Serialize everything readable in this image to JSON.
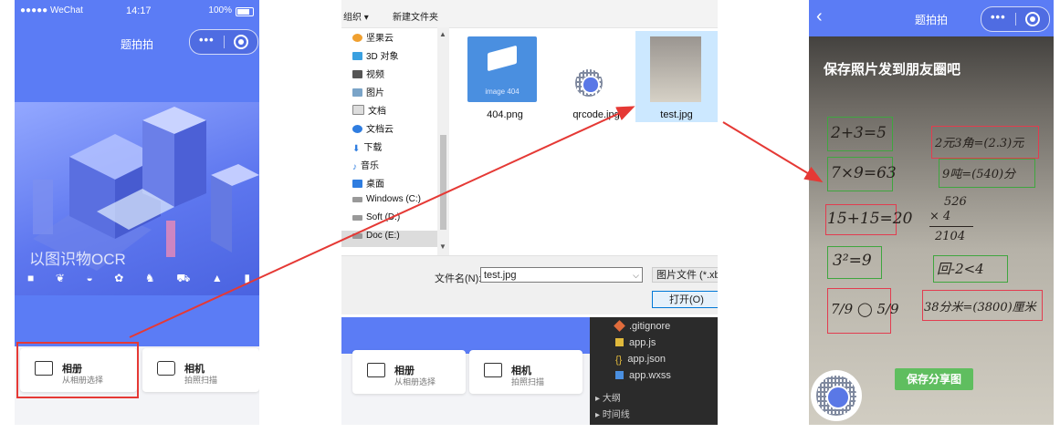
{
  "panel1": {
    "status": {
      "carrier": "●●●●● WeChat",
      "time": "14:17",
      "battery": "100%"
    },
    "title": "题拍拍",
    "capsule": {
      "menu": "•••"
    },
    "banner": {
      "caption": "以图识物OCR"
    },
    "cards": [
      {
        "title": "相册",
        "subtitle": "从相册选择"
      },
      {
        "title": "相机",
        "subtitle": "拍照扫描"
      }
    ]
  },
  "panel2": {
    "toolbar": {
      "organize": "组织 ▾",
      "new_folder": "新建文件夹"
    },
    "tree": [
      "坚果云",
      "3D 对象",
      "视频",
      "图片",
      "文档",
      "文档云",
      "下载",
      "音乐",
      "桌面",
      "Windows (C:)",
      "Soft (D:)",
      "Doc (E:)"
    ],
    "files": [
      {
        "name": "404.png",
        "caption": "image 404"
      },
      {
        "name": "qrcode.jpg"
      },
      {
        "name": "test.jpg"
      }
    ],
    "filename_label": "文件名(N):",
    "filename_value": "test.jpg",
    "filetype": "图片文件 (*.xbr",
    "open_button": "打开(O)",
    "ide_files": [
      ".gitignore",
      "app.js",
      "app.json",
      "app.wxss"
    ],
    "ide_sections": [
      "大纲",
      "时间线"
    ]
  },
  "panel3": {
    "title": "题拍拍",
    "save_tip": "保存照片发到朋友圈吧",
    "share_button": "保存分享图",
    "hand": {
      "left": [
        "2+3=5",
        "7×9=63",
        "15+15=20",
        "3²=9",
        "7/9 ◯ 5/9"
      ],
      "right": [
        "2元3角=(2.3)元",
        "9吨=(540)分",
        "526",
        "×  4",
        "2104",
        "回-2<4",
        "38分米=(3800)厘米"
      ]
    },
    "colors": {
      "correct": "#3fa63f",
      "wrong": "#e23c4f"
    }
  },
  "colors": {
    "accent": "#5b7cf5",
    "arrow": "#e53935"
  }
}
